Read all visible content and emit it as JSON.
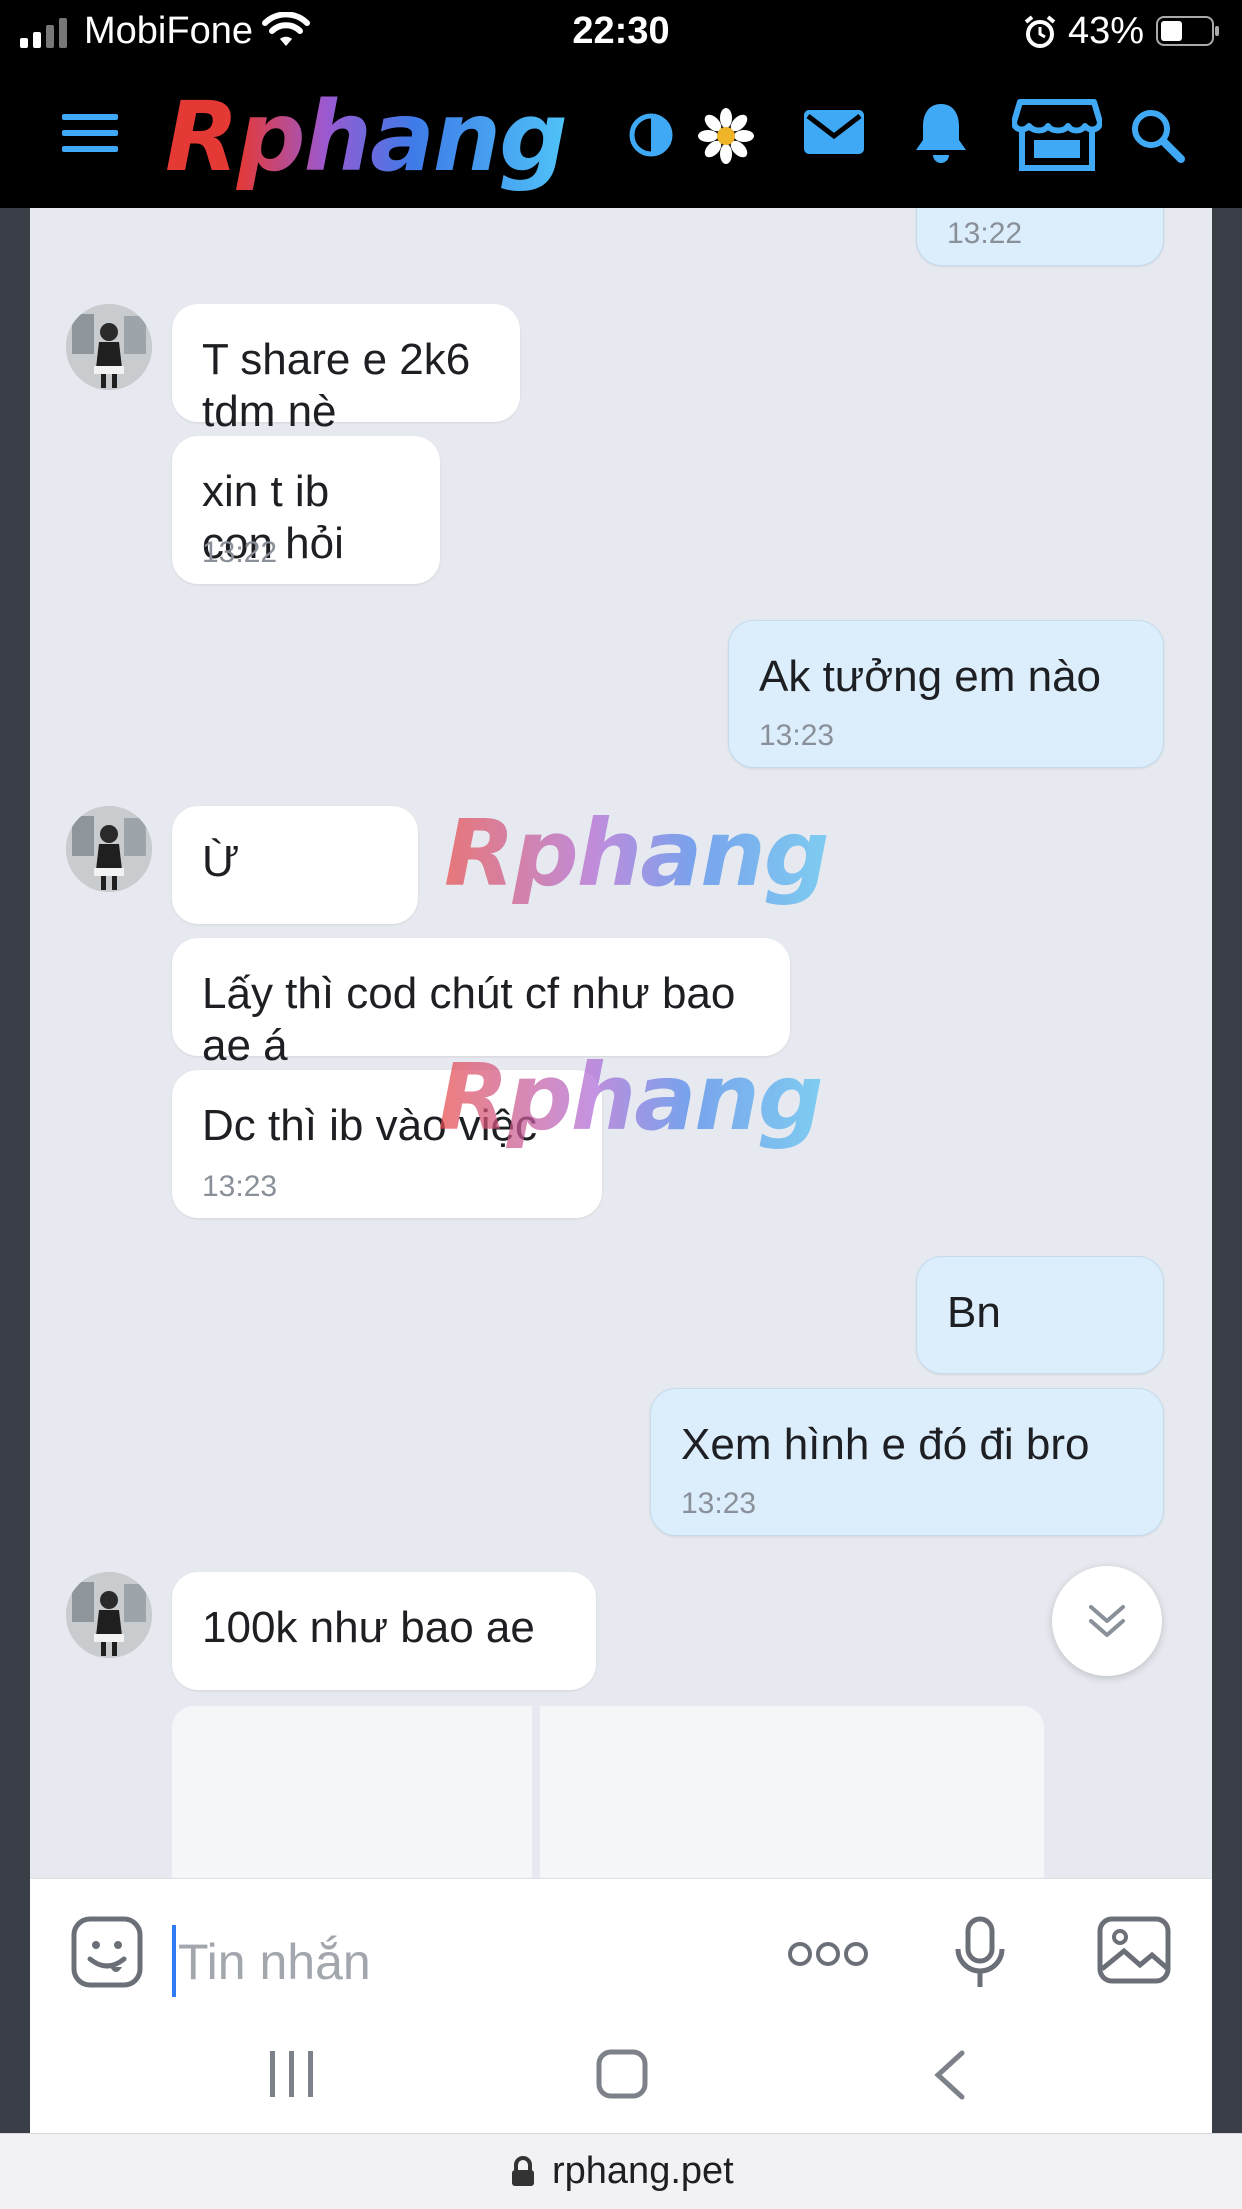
{
  "status_bar": {
    "carrier": "MobiFone",
    "time": "22:30",
    "battery_percent": "43%",
    "battery_level": 0.43
  },
  "header": {
    "logo": "Rphang",
    "icons": [
      "menu-icon",
      "contrast-icon",
      "daisy-icon",
      "mail-icon",
      "bell-icon",
      "store-icon",
      "search-icon"
    ],
    "accent_color": "#3fa9f5"
  },
  "messages": [
    {
      "side": "mine",
      "text": "",
      "time": "13:22"
    },
    {
      "side": "theirs",
      "text": "T share e 2k6 tdm nè",
      "time": ""
    },
    {
      "side": "theirs",
      "text": "xin t ib con hỏi",
      "time": "13:22"
    },
    {
      "side": "mine",
      "text": "Ak tưởng em nào",
      "time": "13:23"
    },
    {
      "side": "theirs",
      "text": "Ừ",
      "time": ""
    },
    {
      "side": "theirs",
      "text": "Lấy thì cod chút cf như bao ae á",
      "time": ""
    },
    {
      "side": "theirs",
      "text": "Dc thì ib vào việc",
      "time": "13:23"
    },
    {
      "side": "mine",
      "text": "Bn",
      "time": ""
    },
    {
      "side": "mine",
      "text": "Xem hình e đó đi bro",
      "time": "13:23"
    },
    {
      "side": "theirs",
      "text": "100k như bao ae",
      "time": ""
    }
  ],
  "watermark": "Rphang",
  "composer": {
    "placeholder": "Tin nhắn",
    "value": ""
  },
  "url_bar": {
    "domain": "rphang.pet"
  },
  "colors": {
    "mine_bubble": "#dcedfb",
    "theirs_bubble": "#ffffff",
    "chat_background": "#e6e9ef",
    "header_background": "#000000"
  }
}
